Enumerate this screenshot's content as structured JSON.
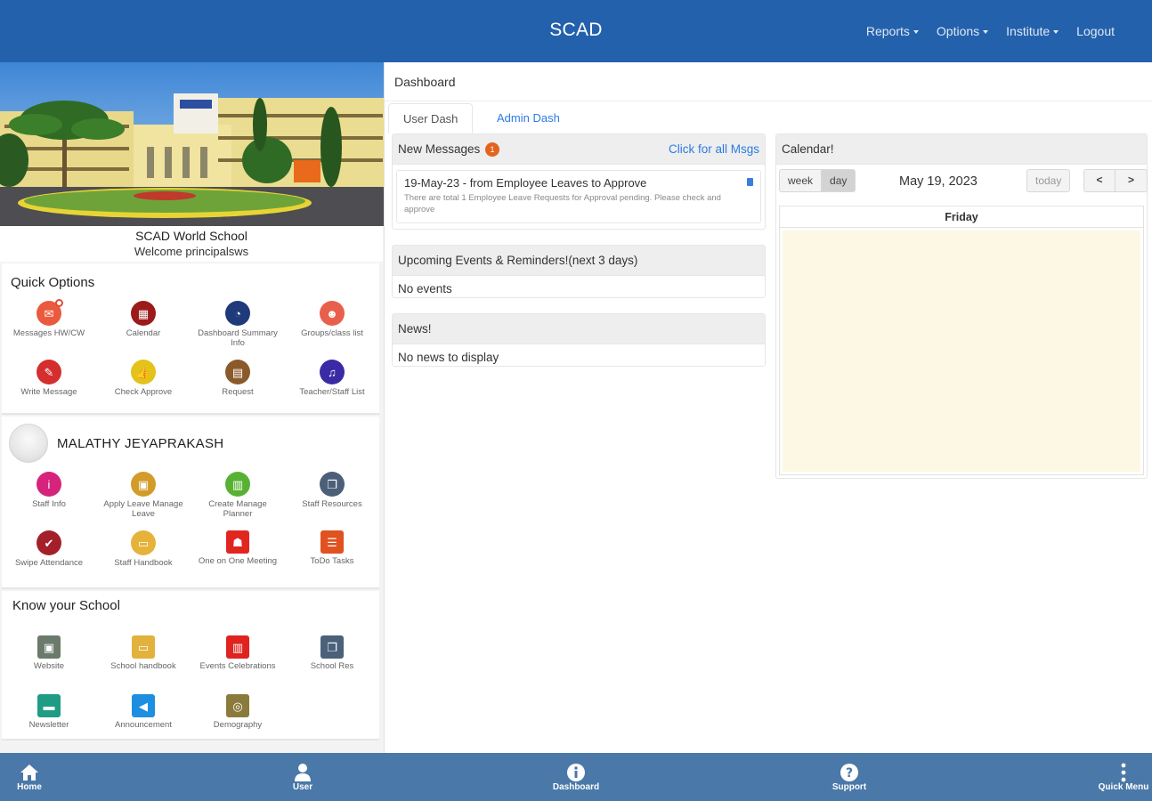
{
  "header": {
    "title": "SCAD",
    "nav": [
      {
        "label": "Reports",
        "dropdown": true
      },
      {
        "label": "Options",
        "dropdown": true
      },
      {
        "label": "Institute",
        "dropdown": true
      },
      {
        "label": "Logout",
        "dropdown": false
      }
    ]
  },
  "school": {
    "name": "SCAD World School",
    "welcome": "Welcome principalsws"
  },
  "quick_options": {
    "title": "Quick Options",
    "items": [
      {
        "label": "Messages HW/CW",
        "icon": "envelope-icon",
        "color": "#ea5a3e"
      },
      {
        "label": "Calendar",
        "icon": "calendar-icon",
        "color": "#9b1b1b"
      },
      {
        "label": "Dashboard Summary Info",
        "icon": "dashboard-icon",
        "color": "#1e3a7a"
      },
      {
        "label": "Groups/class list",
        "icon": "groups-icon",
        "color": "#e8604c"
      },
      {
        "label": "Write Message",
        "icon": "pencil-icon",
        "color": "#d42e2e"
      },
      {
        "label": "Check Approve",
        "icon": "thumbs-up-icon",
        "color": "#e3c21a"
      },
      {
        "label": "Request",
        "icon": "request-icon",
        "color": "#8b5a2b"
      },
      {
        "label": "Teacher/Staff List",
        "icon": "staff-list-icon",
        "color": "#3b2aa6"
      }
    ]
  },
  "user": {
    "name": "MALATHY JEYAPRAKASH",
    "items": [
      {
        "label": "Staff Info",
        "icon": "info-icon",
        "color": "#d6237c"
      },
      {
        "label": "Apply Leave Manage Leave",
        "icon": "leave-icon",
        "color": "#d29b2a"
      },
      {
        "label": "Create Manage Planner",
        "icon": "planner-icon",
        "color": "#57b233"
      },
      {
        "label": "Staff Resources",
        "icon": "resources-icon",
        "color": "#4c5f78"
      },
      {
        "label": "Swipe Attendance",
        "icon": "attendance-icon",
        "color": "#a41f2a"
      },
      {
        "label": "Staff Handbook",
        "icon": "handbook-icon",
        "color": "#e6b23a"
      },
      {
        "label": "One on One Meeting",
        "icon": "meeting-icon",
        "color": "#e0261f"
      },
      {
        "label": "ToDo Tasks",
        "icon": "todo-icon",
        "color": "#e0521f"
      }
    ]
  },
  "know_school": {
    "title": "Know your School",
    "items": [
      {
        "label": "Website",
        "icon": "website-icon",
        "color": "#6b7a6b"
      },
      {
        "label": "School handbook",
        "icon": "handbook-icon",
        "color": "#e3b23c"
      },
      {
        "label": "Events Celebrations",
        "icon": "events-icon",
        "color": "#e0231f"
      },
      {
        "label": "School Res",
        "icon": "school-res-icon",
        "color": "#4a6179"
      },
      {
        "label": "Newsletter",
        "icon": "newsletter-icon",
        "color": "#1e9c84"
      },
      {
        "label": "Announcement",
        "icon": "megaphone-icon",
        "color": "#1e8fe0"
      },
      {
        "label": "Demography",
        "icon": "globe-icon",
        "color": "#8a7a3c"
      }
    ]
  },
  "main": {
    "breadcrumb": "Dashboard",
    "tabs": [
      {
        "label": "User Dash",
        "active": true
      },
      {
        "label": "Admin Dash",
        "active": false
      }
    ],
    "messages": {
      "title": "New Messages",
      "count": "1",
      "link": "Click for all Msgs",
      "items": [
        {
          "title": "19-May-23 - from Employee Leaves to Approve",
          "desc": "There are total 1 Employee Leave Requests for Approval pending. Please check and approve"
        }
      ]
    },
    "events": {
      "title": "Upcoming Events & Reminders!(next 3 days)",
      "body": "No events"
    },
    "news": {
      "title": "News!",
      "body": "No news to display"
    },
    "calendar": {
      "title": "Calendar!",
      "views": [
        "week",
        "day"
      ],
      "active_view": "day",
      "date": "May 19, 2023",
      "today_label": "today",
      "prev": "<",
      "next": ">",
      "day_header": "Friday",
      "day_bg": "#fcf8e4"
    }
  },
  "bottom_nav": [
    {
      "label": "Home",
      "icon": "home-icon"
    },
    {
      "label": "User",
      "icon": "user-icon"
    },
    {
      "label": "Dashboard",
      "icon": "info-circle-icon"
    },
    {
      "label": "Support",
      "icon": "question-circle-icon"
    },
    {
      "label": "Quick Menu",
      "icon": "kebab-menu-icon"
    }
  ]
}
